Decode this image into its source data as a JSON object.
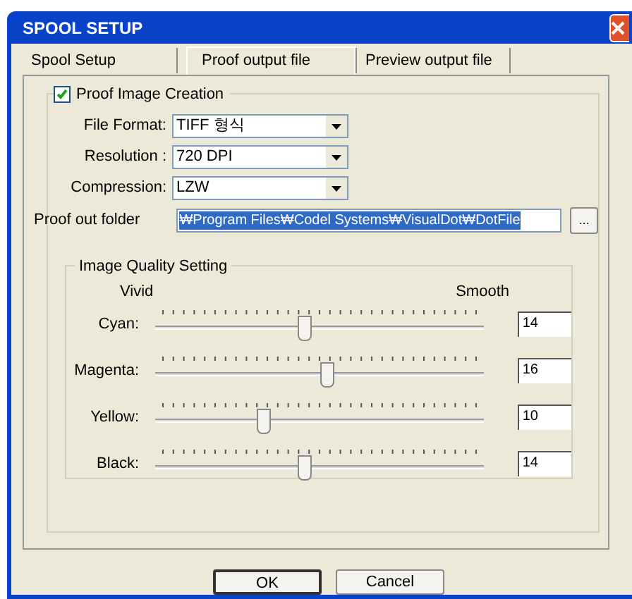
{
  "window": {
    "title": "SPOOL SETUP"
  },
  "tabs": [
    {
      "label": "Spool Setup",
      "selected": false
    },
    {
      "label": "Proof output file",
      "selected": true
    },
    {
      "label": "Preview output file",
      "selected": false
    }
  ],
  "proof_image_creation": {
    "label": "Proof Image Creation",
    "checked": true
  },
  "fields": [
    {
      "label": "File Format:",
      "value": "TIFF 형식"
    },
    {
      "label": "Resolution :",
      "value": "720 DPI"
    },
    {
      "label": "Compression:",
      "value": "LZW"
    }
  ],
  "folder": {
    "label": "Proof out folder",
    "value": "₩Program Files₩Codel Systems₩VisualDot₩DotFile",
    "browse": "..."
  },
  "quality": {
    "title": "Image Quality Setting",
    "left": "Vivid",
    "right": "Smooth",
    "sliders": [
      {
        "label": "Cyan:",
        "level": 0.45,
        "value": "14"
      },
      {
        "label": "Magenta:",
        "level": 0.52,
        "value": "16"
      },
      {
        "label": "Yellow:",
        "level": 0.32,
        "value": "10"
      },
      {
        "label": "Black:",
        "level": 0.45,
        "value": "14"
      }
    ]
  },
  "buttons": [
    "OK",
    "Cancel"
  ]
}
